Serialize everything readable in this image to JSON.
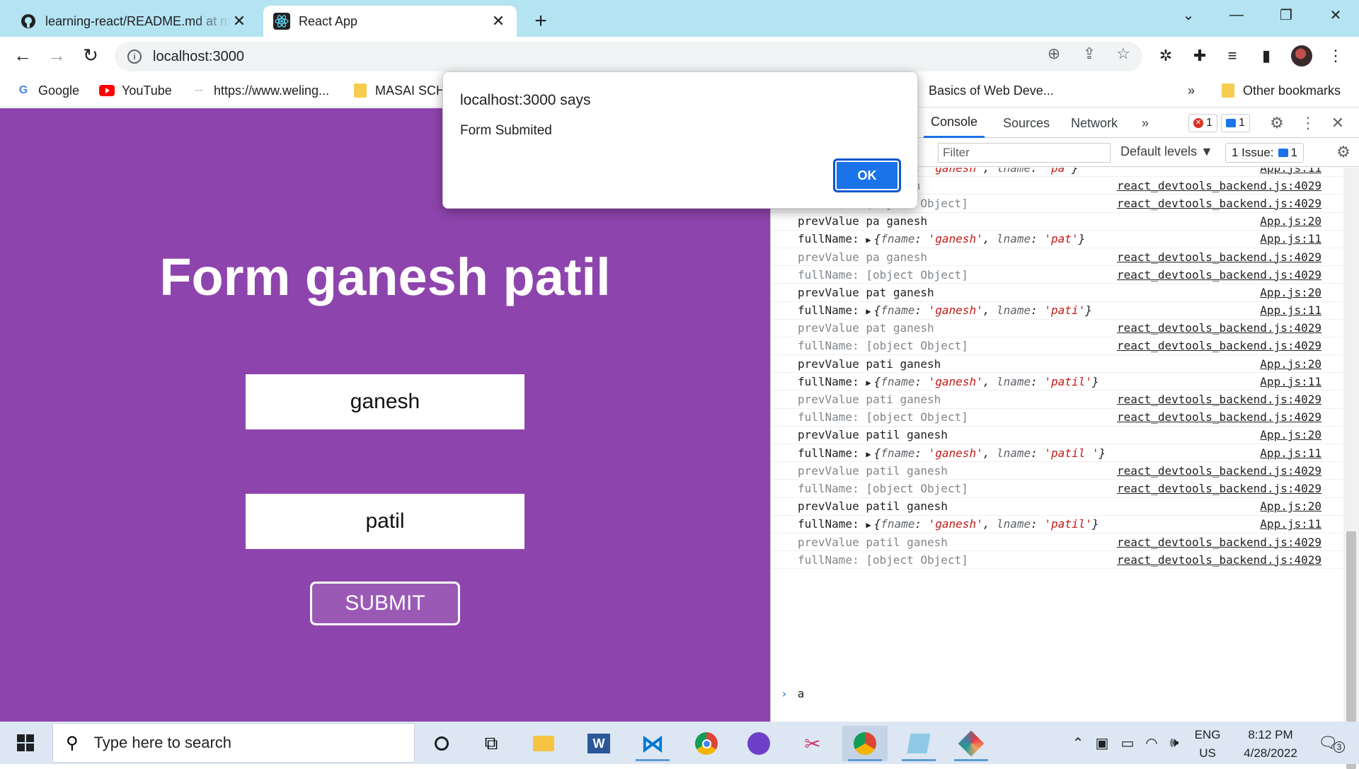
{
  "browser": {
    "tabs": [
      {
        "title": "learning-react/README.md at main",
        "icon": "github-icon",
        "active": false
      },
      {
        "title": "React App",
        "icon": "react-icon",
        "active": true
      }
    ],
    "address": "localhost:3000",
    "bookmarks": [
      {
        "label": "Google",
        "icon": "google-icon"
      },
      {
        "label": "YouTube",
        "icon": "youtube-icon"
      },
      {
        "label": "https://www.weling...",
        "icon": "site-icon"
      },
      {
        "label": "MASAI SCH",
        "icon": "folder-icon"
      },
      {
        "label": "Basics of Web Deve...",
        "icon": "page-icon"
      }
    ],
    "bookmarks_more": "»",
    "other_bookmarks": "Other bookmarks"
  },
  "app": {
    "heading": "Form ganesh patil",
    "first_name_value": "ganesh",
    "last_name_value": "patil",
    "submit_label": "SUBMIT"
  },
  "alert": {
    "title": "localhost:3000 says",
    "message": "Form Submited",
    "ok_label": "OK"
  },
  "devtools": {
    "tabs": [
      "Console",
      "Sources",
      "Network"
    ],
    "more_tabs": "»",
    "error_count": "1",
    "message_count": "1",
    "filter_placeholder": "Filter",
    "levels_label": "Default levels ▼",
    "issues_label": "1 Issue:",
    "issues_count": "1",
    "console_input": "a",
    "logs": [
      {
        "type": "obj",
        "fname": "'ganesh'",
        "lname": "'pa'",
        "src": "App.js:11",
        "partial": true
      },
      {
        "type": "dim",
        "text": "prevValue p ganesh",
        "src": "react_devtools_backend.js:4029"
      },
      {
        "type": "dim",
        "text": "fullName: [object Object]",
        "src": "react_devtools_backend.js:4029"
      },
      {
        "type": "log",
        "text": "prevValue pa ganesh",
        "src": "App.js:20"
      },
      {
        "type": "obj",
        "fname": "'ganesh'",
        "lname": "'pat'",
        "src": "App.js:11"
      },
      {
        "type": "dim",
        "text": "prevValue pa ganesh",
        "src": "react_devtools_backend.js:4029"
      },
      {
        "type": "dim",
        "text": "fullName: [object Object]",
        "src": "react_devtools_backend.js:4029"
      },
      {
        "type": "log",
        "text": "prevValue pat ganesh",
        "src": "App.js:20"
      },
      {
        "type": "obj",
        "fname": "'ganesh'",
        "lname": "'pati'",
        "src": "App.js:11"
      },
      {
        "type": "dim",
        "text": "prevValue pat ganesh",
        "src": "react_devtools_backend.js:4029"
      },
      {
        "type": "dim",
        "text": "fullName: [object Object]",
        "src": "react_devtools_backend.js:4029"
      },
      {
        "type": "log",
        "text": "prevValue pati ganesh",
        "src": "App.js:20"
      },
      {
        "type": "obj",
        "fname": "'ganesh'",
        "lname": "'patil'",
        "src": "App.js:11"
      },
      {
        "type": "dim",
        "text": "prevValue pati ganesh",
        "src": "react_devtools_backend.js:4029"
      },
      {
        "type": "dim",
        "text": "fullName: [object Object]",
        "src": "react_devtools_backend.js:4029"
      },
      {
        "type": "log",
        "text": "prevValue patil ganesh",
        "src": "App.js:20"
      },
      {
        "type": "obj",
        "fname": "'ganesh'",
        "lname": "'patil '",
        "src": "App.js:11"
      },
      {
        "type": "dim",
        "text": "prevValue patil ganesh",
        "src": "react_devtools_backend.js:4029"
      },
      {
        "type": "dim",
        "text": "fullName: [object Object]",
        "src": "react_devtools_backend.js:4029"
      },
      {
        "type": "log",
        "text": "prevValue patil  ganesh",
        "src": "App.js:20"
      },
      {
        "type": "obj",
        "fname": "'ganesh'",
        "lname": "'patil'",
        "src": "App.js:11"
      },
      {
        "type": "dim",
        "text": "prevValue patil  ganesh",
        "src": "react_devtools_backend.js:4029"
      },
      {
        "type": "dim",
        "text": "fullName: [object Object]",
        "src": "react_devtools_backend.js:4029"
      }
    ]
  },
  "taskbar": {
    "search_placeholder": "Type here to search",
    "apps": [
      "cortana-icon",
      "task-view-icon",
      "file-explorer-icon",
      "word-icon",
      "vscode-icon",
      "chrome-icon",
      "github-desktop-icon",
      "snipping-tool-icon",
      "chrome-profile-icon",
      "notepad-icon",
      "paint-icon"
    ],
    "language": "ENG",
    "region": "US",
    "time": "8:12 PM",
    "date": "4/28/2022",
    "notification_count": "3"
  },
  "colors": {
    "page_bg": "#8e44ad",
    "button_bg": "#9b59b6",
    "tab_strip": "#b4e3f2",
    "accent": "#1a73e8",
    "string": "#c41a16"
  }
}
